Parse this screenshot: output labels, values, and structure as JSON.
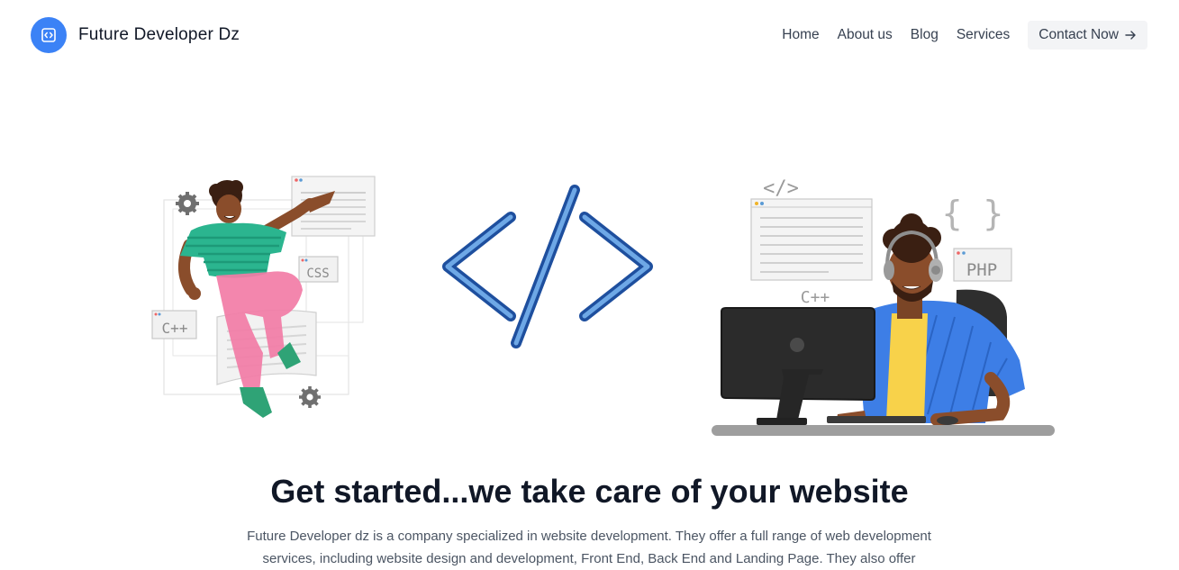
{
  "header": {
    "brand": "Future Developer Dz",
    "nav": [
      "Home",
      "About us",
      "Blog",
      "Services"
    ],
    "cta": "Contact Now",
    "cta_icon": "arrow-right-icon",
    "logo_icon": "code-bracket-icon"
  },
  "hero": {
    "left_illustration": {
      "labels": [
        "CSS",
        "C++"
      ]
    },
    "right_illustration": {
      "labels": [
        "</>",
        "{ }",
        "PHP",
        "C++"
      ]
    },
    "headline": "Get started...we take care of your website",
    "description": "Future Developer dz is a company specialized in website development. They offer a full range of web development services, including website design and development, Front End, Back End and Landing Page. They also offer"
  },
  "colors": {
    "accent": "#3b82f6",
    "code_symbol_dark": "#1e4f9e",
    "code_symbol_light": "#6ea8e6"
  }
}
